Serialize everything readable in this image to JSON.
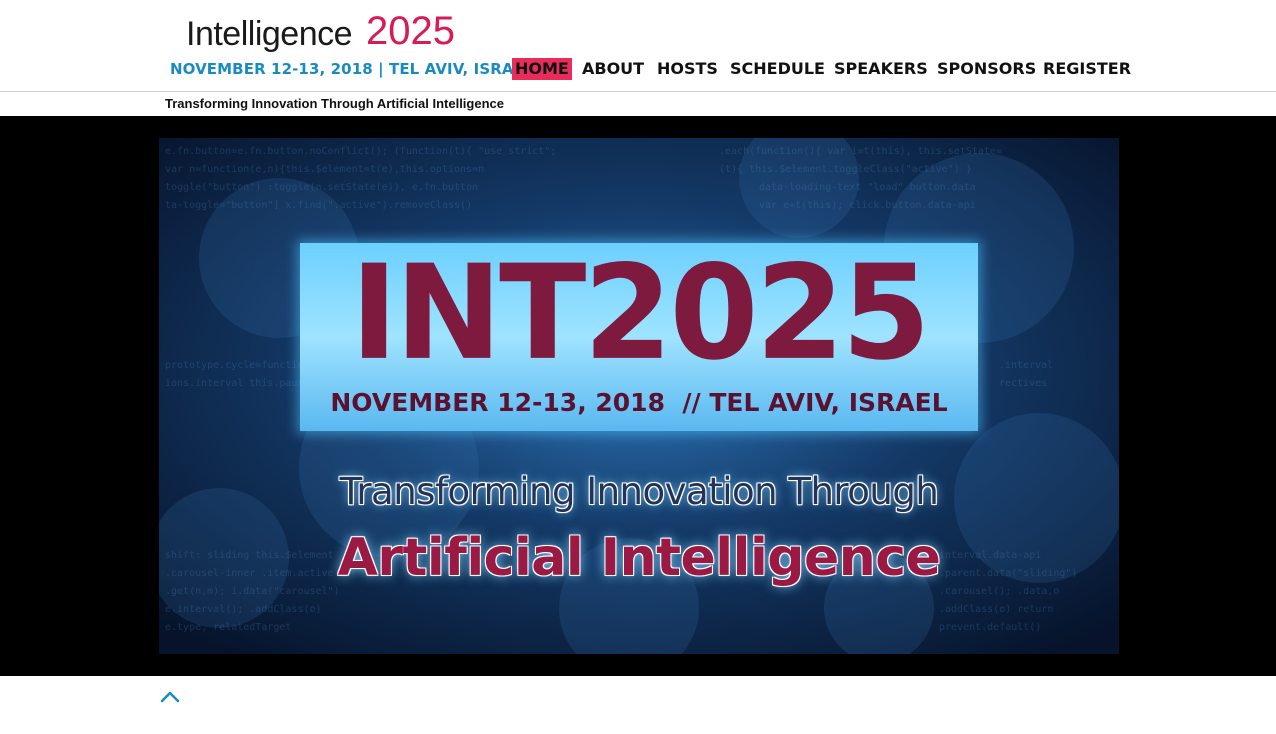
{
  "logo": {
    "word": "Intelligence",
    "year": "2025",
    "date_line": "NOVEMBER 12-13, 2018 | TEL AVIV, ISRAEL"
  },
  "nav": {
    "items": [
      {
        "label": "HOME",
        "active": true
      },
      {
        "label": "ABOUT"
      },
      {
        "label": "HOSTS"
      },
      {
        "label": "SCHEDULE"
      },
      {
        "label": "SPEAKERS"
      },
      {
        "label": "SPONSORS"
      },
      {
        "label": "REGISTER"
      }
    ]
  },
  "tagline": "Transforming Innovation Through Artificial Intelligence",
  "hero": {
    "big_title": "INT2025",
    "date_line": "NOVEMBER 12-13, 2018  // TEL AVIV, ISRAEL",
    "line1": "Transforming Innovation Through",
    "line2": "Artificial Intelligence"
  },
  "colors": {
    "accent": "#ea2c5c",
    "brand_blue": "#1a8bc1",
    "hero_title": "#8a1a40"
  },
  "icons": {
    "scroll_top": "chevron-up-icon"
  }
}
